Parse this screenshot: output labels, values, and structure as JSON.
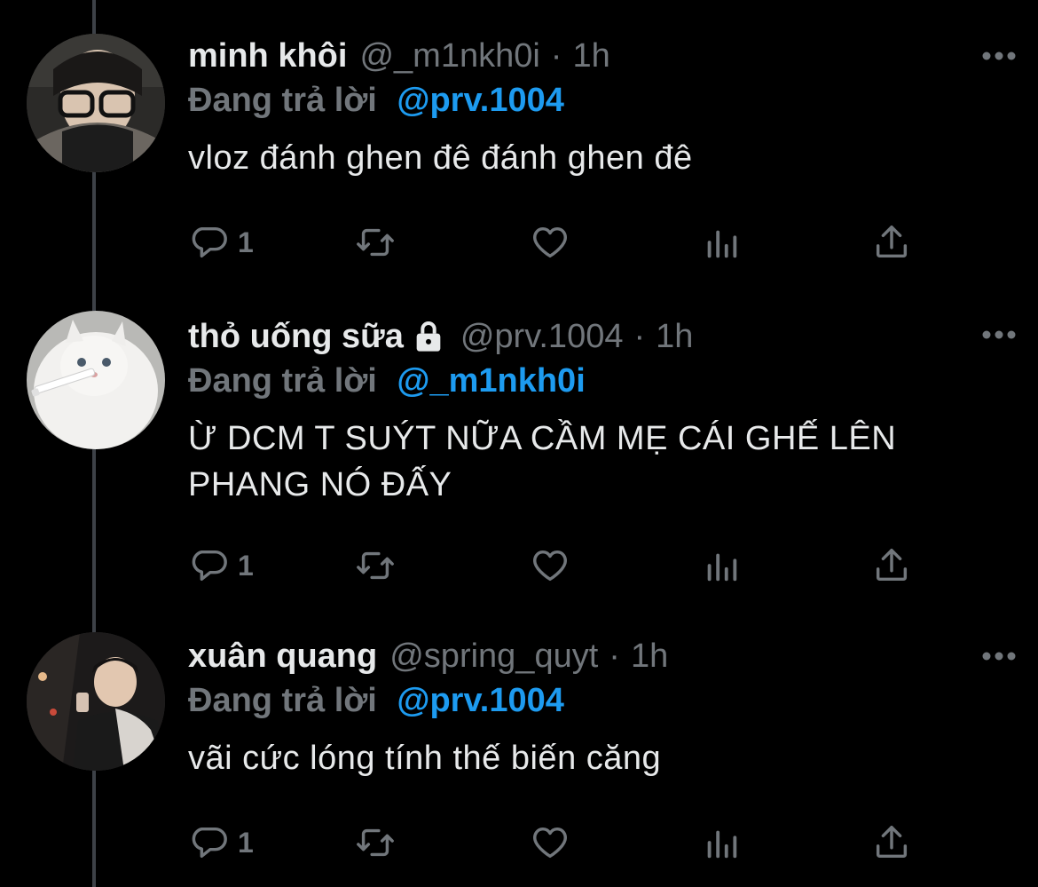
{
  "reply_prefix": "Đang trả lời",
  "separator": "·",
  "colors": {
    "background": "#000000",
    "muted": "#71767b",
    "accent": "#1d9bf0",
    "text": "#e7e9ea"
  },
  "icons": {
    "reply": "reply-bubble-icon",
    "retweet": "retweet-icon",
    "like": "heart-icon",
    "stats": "analytics-icon",
    "share": "share-icon",
    "more": "more-dots-icon",
    "lock": "lock-icon"
  },
  "tweets": [
    {
      "display_name": "minh khôi",
      "handle": "@_m1nkh0i",
      "time": "1h",
      "reply_to": "@prv.1004",
      "text": "vloz đánh ghen đê đánh ghen đê",
      "reply_count": "1"
    },
    {
      "display_name": "thỏ uống sữa",
      "handle": "@prv.1004",
      "time": "1h",
      "reply_to": "@_m1nkh0i",
      "text": "Ừ DCM T SUÝT NỮA CẦM MẸ CÁI GHẾ LÊN PHANG NÓ ĐẤY",
      "reply_count": "1"
    },
    {
      "display_name": "xuân quang",
      "handle": "@spring_quyt",
      "time": "1h",
      "reply_to": "@prv.1004",
      "text": "vãi cức lóng tính thế biến căng",
      "reply_count": "1"
    }
  ]
}
